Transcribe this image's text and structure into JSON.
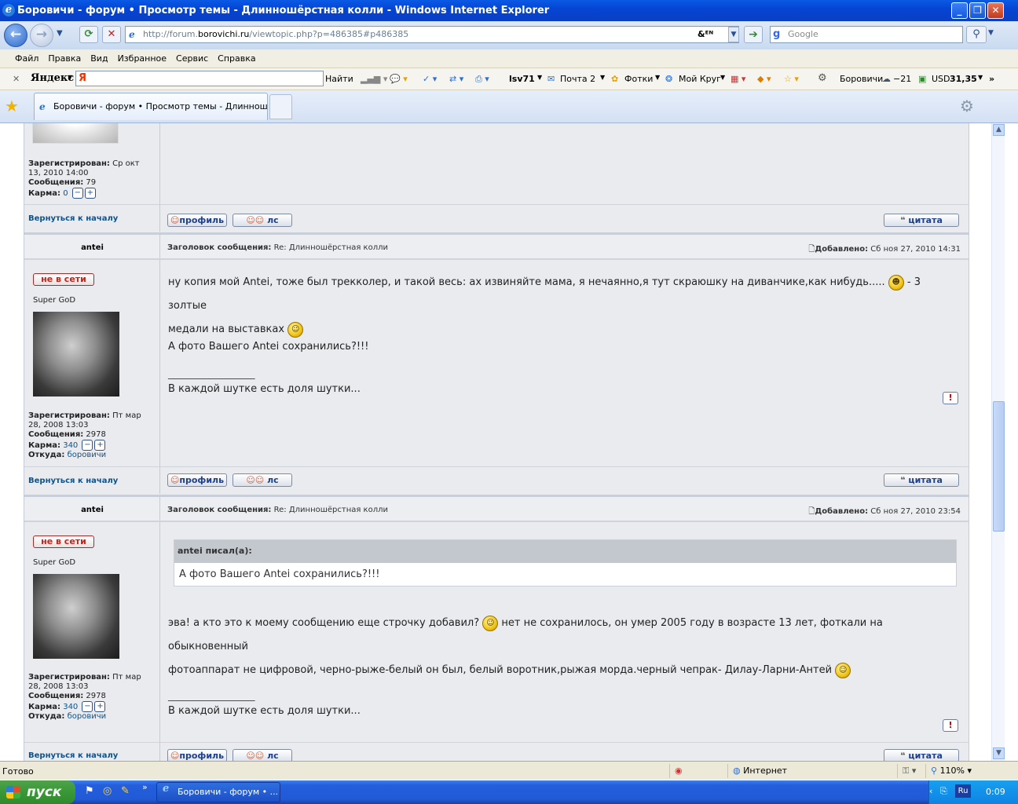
{
  "window": {
    "title": "Боровичи - форум • Просмотр темы - Длинношёрстная колли - Windows Internet Explorer",
    "min": "_",
    "max": "❐",
    "close": "✕"
  },
  "address": {
    "url_prefix": "http://forum.",
    "url_host": "borovichi.ru",
    "url_suffix": "/viewtopic.php?p=486385#p486385",
    "search_placeholder": "Google"
  },
  "menu": [
    "Файл",
    "Правка",
    "Вид",
    "Избранное",
    "Сервис",
    "Справка"
  ],
  "yandex_bar": {
    "brand": "Яндекс",
    "input_value": "Я",
    "find": "Найти",
    "user": "lsv71",
    "mail": "Почта 2",
    "photos": "Фотки",
    "circle": "Мой Круг",
    "weather": "Боровичи",
    "temp": "−21",
    "currency": "USD",
    "rate": "31,35"
  },
  "tabs": [
    {
      "label": "Боровичи - форум • Просмотр темы - Длинношёрст..."
    }
  ],
  "common": {
    "back_to_top": "Вернуться к началу",
    "profile": "профиль",
    "pm": "лс",
    "quote": "цитата",
    "offline": "не в сети",
    "rank": "Super GoD",
    "registered_label": "Зарегистрирован:",
    "messages_label": "Сообщения:",
    "karma_label": "Карма:",
    "from_label": "Откуда:",
    "subject_label": "Заголовок сообщения:",
    "added_label": "Добавлено:",
    "minus": "−",
    "plus": "+",
    "report": "!"
  },
  "prev_post": {
    "registered": "Ср окт 13, 2010 14:00",
    "messages": "79",
    "karma": "0"
  },
  "posts": [
    {
      "author": "antei",
      "subject": "Re: Длинношёрстная колли",
      "date": "Сб ноя 27, 2010 14:31",
      "registered": "Пт мар 28, 2008 13:03",
      "messages": "2978",
      "karma": "340",
      "from": "боровичи",
      "line1": "ну копия мой Antei, тоже был трекколер, и такой весь: ах извиняйте мама, я нечаянно,я тут скраюшку на диванчике,как нибудь.....",
      "line1b": "- 3 золтые",
      "line2": "медали на выставках",
      "line3": "А фото Вашего Antei сохранились?!!!",
      "signature_rule": "_________________",
      "signature": "В каждой шутке есть доля шутки..."
    },
    {
      "author": "antei",
      "subject": "Re: Длинношёрстная колли",
      "date": "Сб ноя 27, 2010 23:54",
      "registered": "Пт мар 28, 2008 13:03",
      "messages": "2978",
      "karma": "340",
      "from": "боровичи",
      "quote_author": "antei писал(а):",
      "quote_text": "А фото Вашего Antei сохранились?!!!",
      "line1": "эва! а кто это к моему сообщению еще строчку добавил?",
      "line1b": "нет не сохранилось, он умер 2005 году в возрасте 13 лет, фоткали на обыкновенный",
      "line2": "фотоаппарат не цифровой, черно-рыже-белый он был, белый воротник,рыжая морда.черный чепрак- Дилау-Ларни-Антей",
      "signature_rule": "_________________",
      "signature": "В каждой шутке есть доля шутки..."
    }
  ],
  "status": {
    "left": "Готово",
    "zone": "Интернет",
    "zoom": "110%"
  },
  "taskbar": {
    "start": "пуск",
    "task": "Боровичи - форум • ...",
    "lang": "Ru",
    "time": "0:09"
  }
}
